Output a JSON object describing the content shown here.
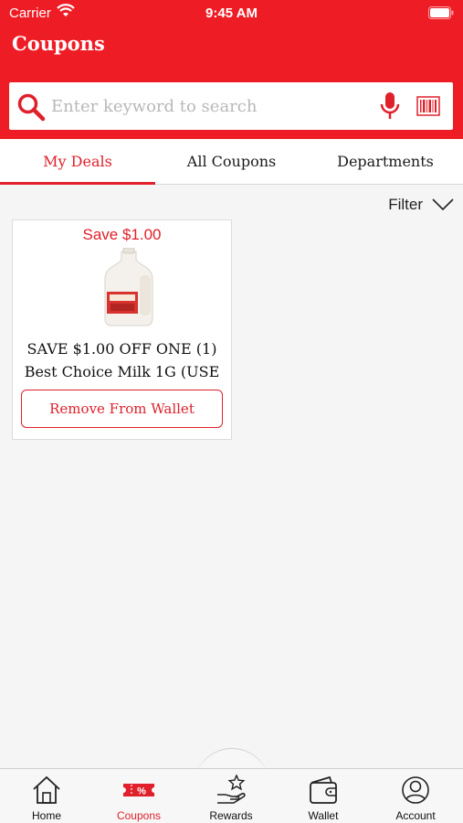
{
  "status_bar": {
    "carrier": "Carrier",
    "time": "9:45 AM"
  },
  "header": {
    "title": "Coupons",
    "accent_color": "#ee1c25"
  },
  "search": {
    "placeholder": "Enter keyword to search"
  },
  "tabs": [
    {
      "label": "My Deals",
      "active": true
    },
    {
      "label": "All Coupons",
      "active": false
    },
    {
      "label": "Departments",
      "active": false
    }
  ],
  "filter": {
    "label": "Filter"
  },
  "coupons": [
    {
      "save_text": "Save $1.00",
      "description": "SAVE $1.00 OFF ONE (1) Best Choice Milk 1G (USE",
      "action_label": "Remove From Wallet",
      "image": "milk-gallon"
    }
  ],
  "bottom_nav": [
    {
      "label": "Home",
      "icon": "home-icon",
      "active": false
    },
    {
      "label": "Coupons",
      "icon": "coupon-icon",
      "active": true,
      "icon_text": "%"
    },
    {
      "label": "Rewards",
      "icon": "rewards-icon",
      "active": false
    },
    {
      "label": "Wallet",
      "icon": "wallet-icon",
      "active": false
    },
    {
      "label": "Account",
      "icon": "account-icon",
      "active": false
    }
  ]
}
